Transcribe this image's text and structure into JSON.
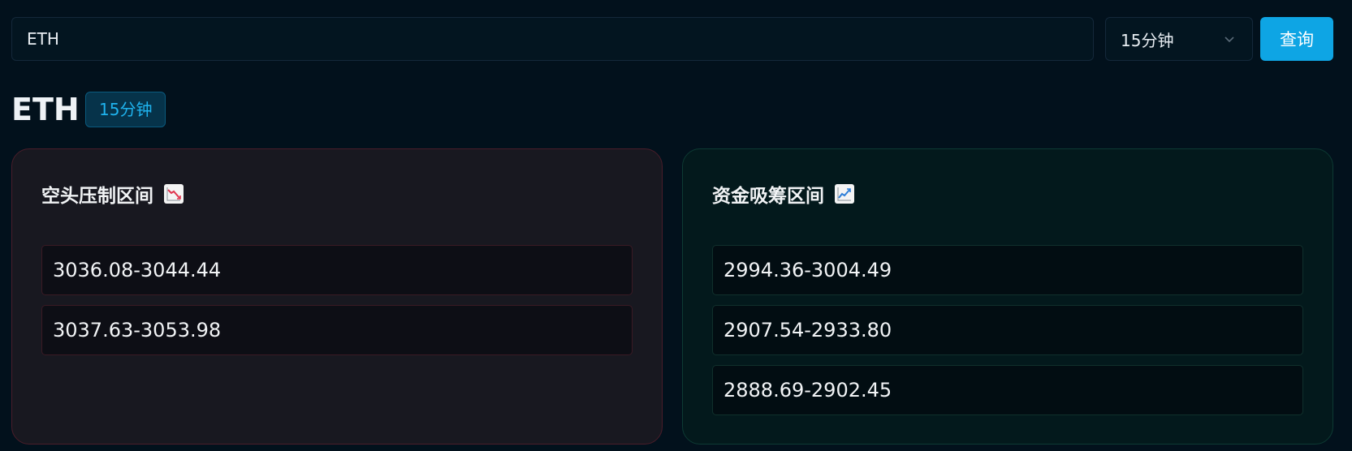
{
  "search": {
    "value": "ETH"
  },
  "interval_select": {
    "selected": "15分钟"
  },
  "query_button": {
    "label": "查询"
  },
  "header": {
    "symbol": "ETH",
    "interval_badge": "15分钟"
  },
  "bear_zone": {
    "title": "空头压制区间",
    "icon": "chart-decreasing-icon",
    "ranges": [
      "3036.08-3044.44",
      "3037.63-3053.98"
    ]
  },
  "bull_zone": {
    "title": "资金吸筹区间",
    "icon": "chart-increasing-icon",
    "ranges": [
      "2994.36-3004.49",
      "2907.54-2933.80",
      "2888.69-2902.45"
    ]
  },
  "colors": {
    "background": "#02111c",
    "accent": "#0ea5e4",
    "bear_border": "#4a1d2a",
    "bull_border": "#0d3a33"
  }
}
